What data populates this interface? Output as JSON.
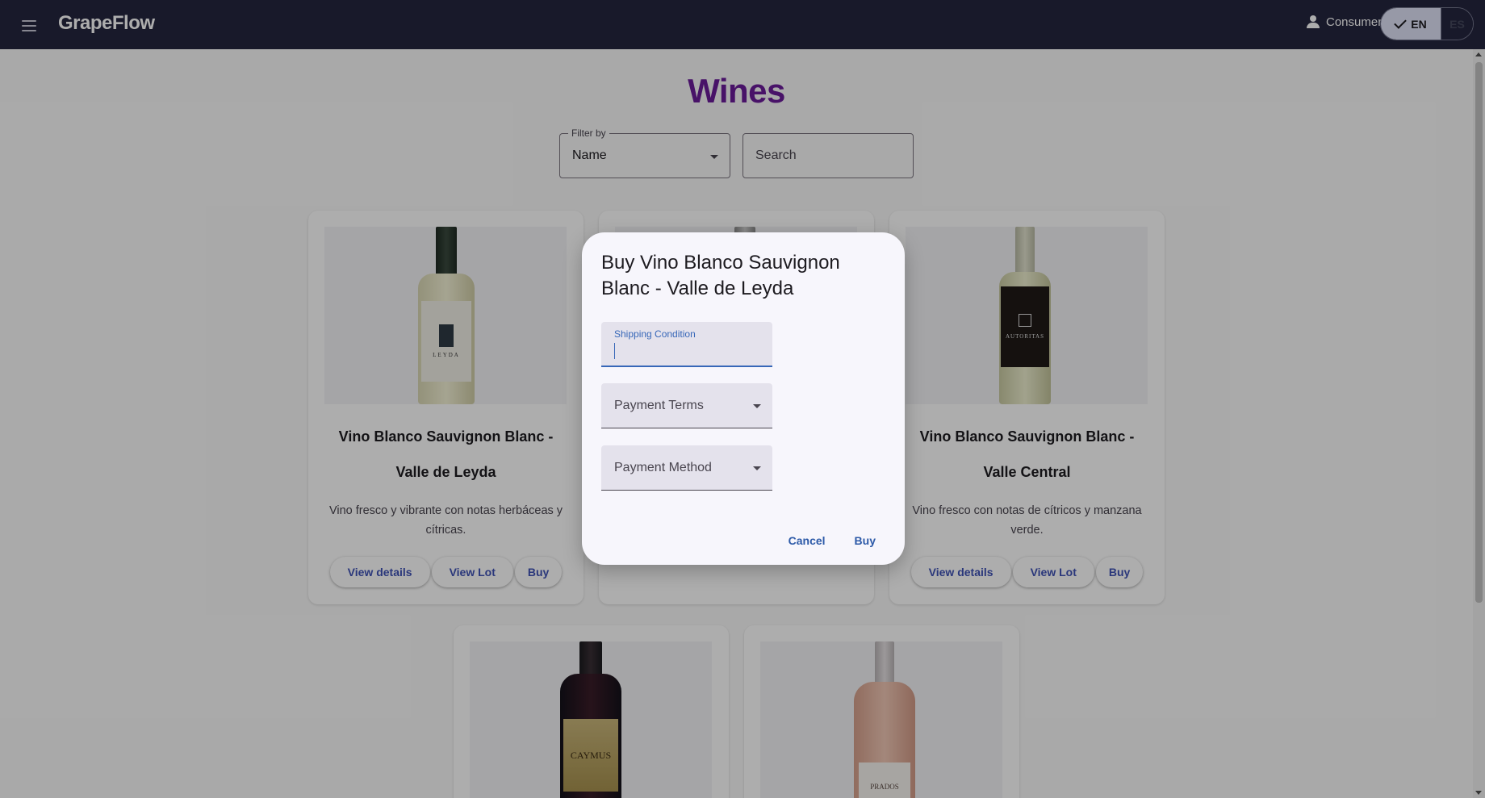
{
  "app": {
    "brand": "GrapeFlow"
  },
  "header": {
    "user_label": "Consumer",
    "languages": [
      {
        "code": "EN",
        "selected": true
      },
      {
        "code": "ES",
        "selected": false
      }
    ]
  },
  "page": {
    "title": "Wines",
    "filter": {
      "label": "Filter by",
      "value": "Name"
    },
    "search": {
      "placeholder": "Search"
    }
  },
  "wines": [
    {
      "name": "Vino Blanco Sauvignon Blanc - Valle de Leyda",
      "description": "Vino fresco y vibrante con notas herbáceas y cítricas.",
      "label_text": "LEYDA",
      "actions": {
        "details": "View details",
        "lot": "View Lot",
        "buy": "Buy"
      }
    },
    {
      "name": "Vino Blanco Sauvignon Blanc - Valle Central",
      "description": "Vino fresco con notas de cítricos y manzana verde.",
      "label_text": "AUTORITAS",
      "actions": {
        "details": "View details",
        "lot": "View Lot",
        "buy": "Buy"
      }
    },
    {
      "label_text": "CAYMUS"
    },
    {
      "label_text": "PRADOS"
    }
  ],
  "dialog": {
    "title": "Buy Vino Blanco Sauvignon Blanc - Valle de Leyda",
    "shipping_label": "Shipping Condition",
    "payment_terms_label": "Payment Terms",
    "payment_method_label": "Payment Method",
    "cancel_label": "Cancel",
    "buy_label": "Buy"
  },
  "colors": {
    "toolbar": "#24253f",
    "title": "#6a1b9a",
    "accent": "#3767b8",
    "button_text": "#3f51b5"
  }
}
